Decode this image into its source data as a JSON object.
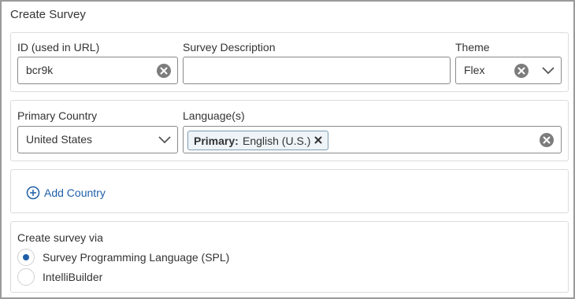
{
  "title": "Create Survey",
  "id_section": {
    "id_label": "ID (used in URL)",
    "id_value": "bcr9k",
    "description_label": "Survey Description",
    "description_value": "",
    "theme_label": "Theme",
    "theme_value": "Flex"
  },
  "country_section": {
    "primary_country_label": "Primary Country",
    "primary_country_value": "United States",
    "languages_label": "Language(s)",
    "languages": [
      {
        "prefix": "Primary:",
        "value": "English (U.S.)"
      }
    ]
  },
  "add_country_label": "Add Country",
  "method_section": {
    "label": "Create survey via",
    "options": [
      {
        "label": "Survey Programming Language (SPL)",
        "selected": true
      },
      {
        "label": "IntelliBuilder",
        "selected": false
      }
    ]
  },
  "colors": {
    "accent": "#1f5fa8",
    "border": "#dcdcdc",
    "input_border": "#8a8a8a",
    "chip_bg": "#eef4f8"
  },
  "icons": [
    "clear-icon",
    "chevron-down-icon",
    "remove-icon",
    "plus-circle-icon"
  ]
}
